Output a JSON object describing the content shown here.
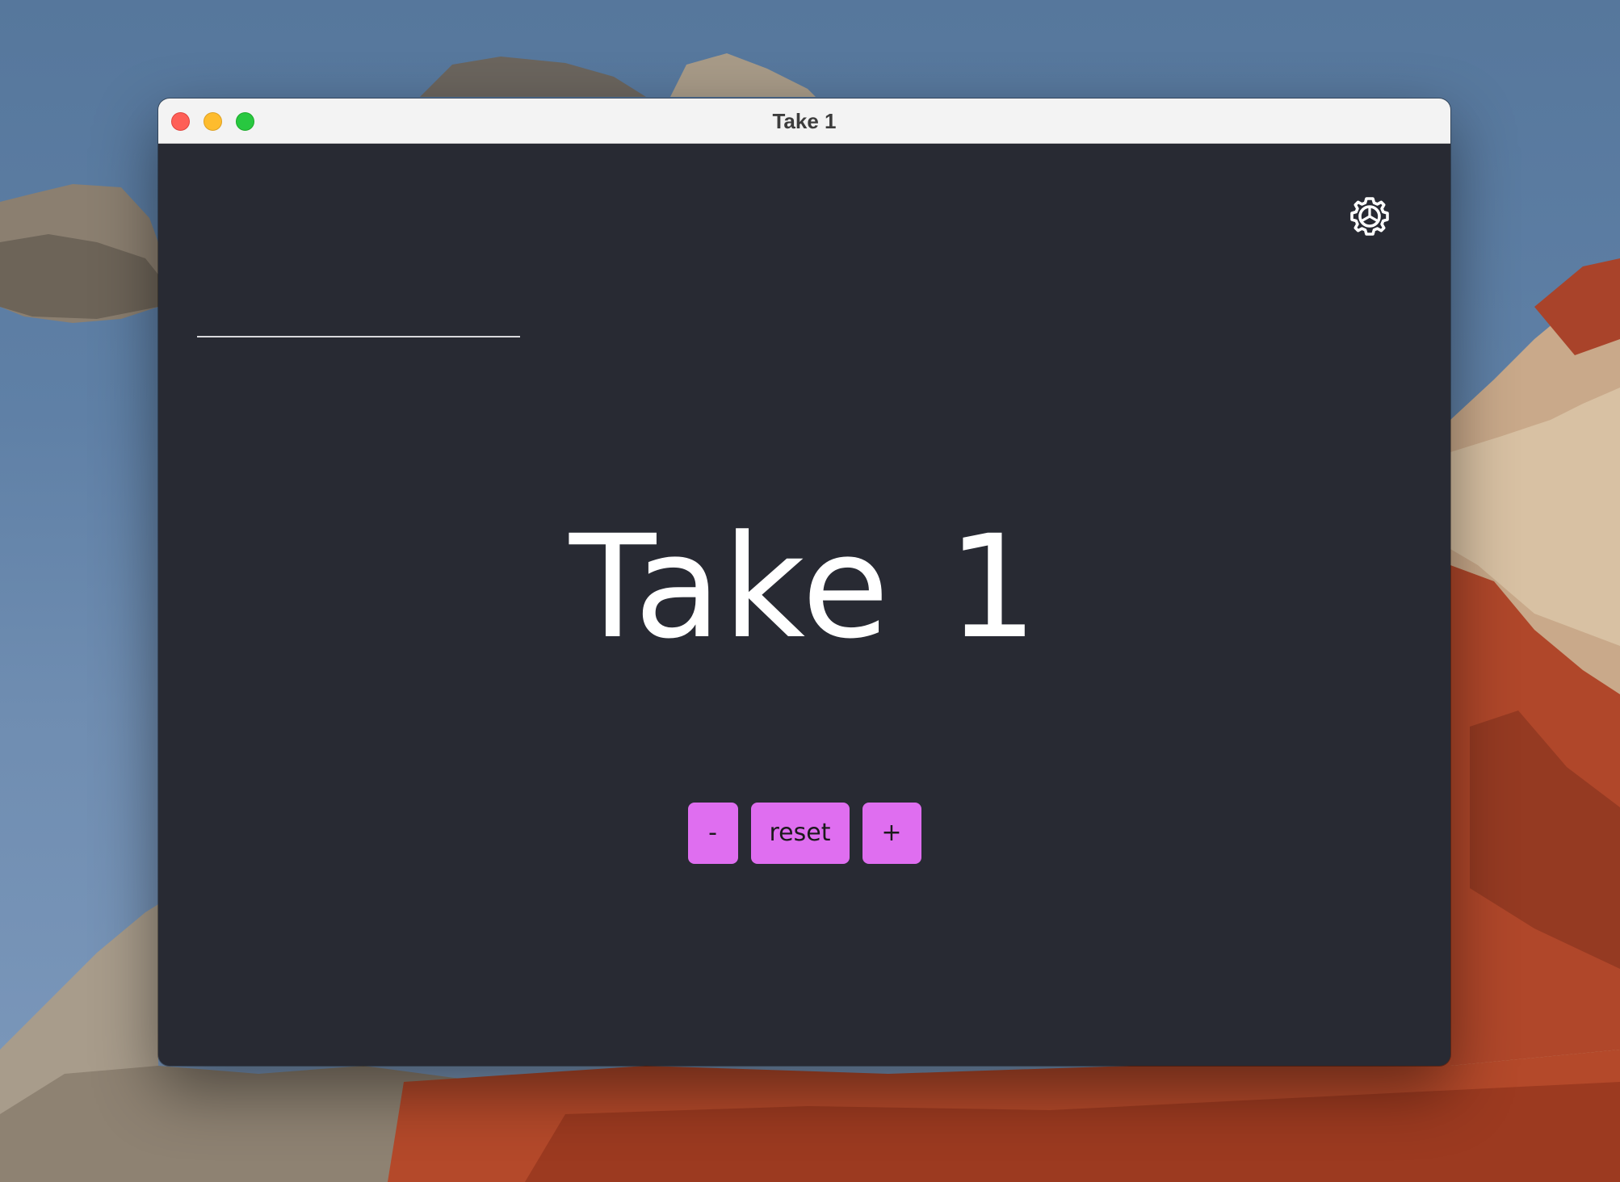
{
  "window": {
    "title": "Take 1"
  },
  "name_field": {
    "value": "",
    "placeholder": ""
  },
  "take": {
    "word": "Take",
    "number": "1"
  },
  "controls": {
    "decrement_label": "-",
    "reset_label": "reset",
    "increment_label": "+"
  },
  "icons": {
    "settings": "gear-icon"
  },
  "colors": {
    "content_background": "#282a33",
    "button_accent": "#df6ef0",
    "titlebar": "#f3f3f3",
    "traffic_close": "#fe5f57",
    "traffic_minimize": "#febc2e",
    "traffic_zoom": "#28c840"
  }
}
